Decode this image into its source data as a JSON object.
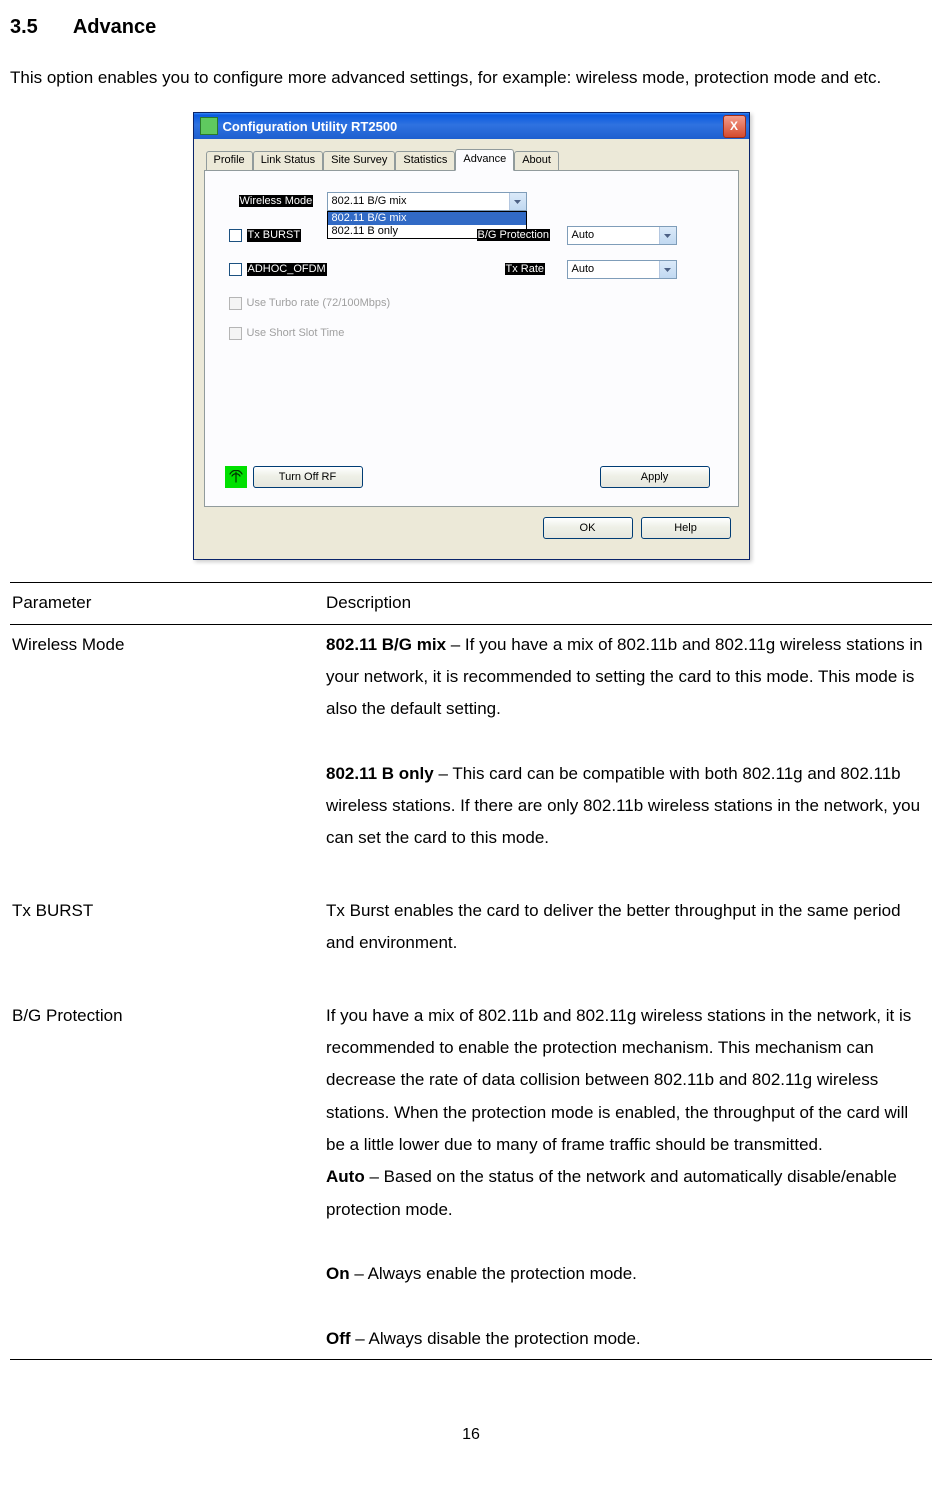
{
  "heading": {
    "number": "3.5",
    "title": "Advance"
  },
  "intro": "This option enables you to configure more advanced settings, for example: wireless mode, protection mode and etc.",
  "dialog": {
    "title": "Configuration Utility RT2500",
    "close": "X",
    "tabs": [
      "Profile",
      "Link Status",
      "Site Survey",
      "Statistics",
      "Advance",
      "About"
    ],
    "active_tab": 4,
    "wireless_mode_label": "Wireless Mode",
    "wireless_mode_value": "802.11 B/G mix",
    "wireless_mode_options": [
      "802.11 B/G mix",
      "802.11 B only"
    ],
    "tx_burst_label": "Tx BURST",
    "adhoc_label": "ADHOC_OFDM",
    "turbo_label": "Use Turbo rate (72/100Mbps)",
    "short_slot_label": "Use Short Slot Time",
    "bg_protection_label": "B/G Protection",
    "bg_protection_value": "Auto",
    "tx_rate_label": "Tx Rate",
    "tx_rate_value": "Auto",
    "turn_off_rf": "Turn Off RF",
    "apply": "Apply",
    "ok": "OK",
    "help": "Help"
  },
  "table": {
    "header_param": "Parameter",
    "header_desc": "Description",
    "rows": {
      "wireless_mode": {
        "param": "Wireless Mode",
        "bg_mix_label": "802.11 B/G mix",
        "bg_mix_text": " – If you have a mix of 802.11b and 802.11g wireless stations in your network, it is recommended to setting the card to this mode. This mode is also the default setting.",
        "b_only_label": "802.11 B only",
        "b_only_text": " – This card can be compatible with both 802.11g and 802.11b wireless stations. If there are only 802.11b wireless stations in the network, you can set the card to this mode."
      },
      "tx_burst": {
        "param": "Tx BURST",
        "text": "Tx Burst enables the card to deliver the better throughput in the same period and environment."
      },
      "bg_protection": {
        "param": "B/G Protection",
        "intro": "If you have a mix of 802.11b and 802.11g wireless stations in the network, it is recommended to enable the protection mechanism. This mechanism can decrease the rate of data collision between 802.11b and 802.11g wireless stations. When the protection mode is enabled, the throughput of the card will be a little lower due to many of frame traffic should be transmitted.",
        "auto_label": "Auto",
        "auto_text": " – Based on the status of the network and automatically disable/enable protection mode.",
        "on_label": "On",
        "on_text": " – Always enable the protection mode.",
        "off_label": "Off",
        "off_text": " – Always disable the protection mode."
      }
    }
  },
  "page_number": "16"
}
